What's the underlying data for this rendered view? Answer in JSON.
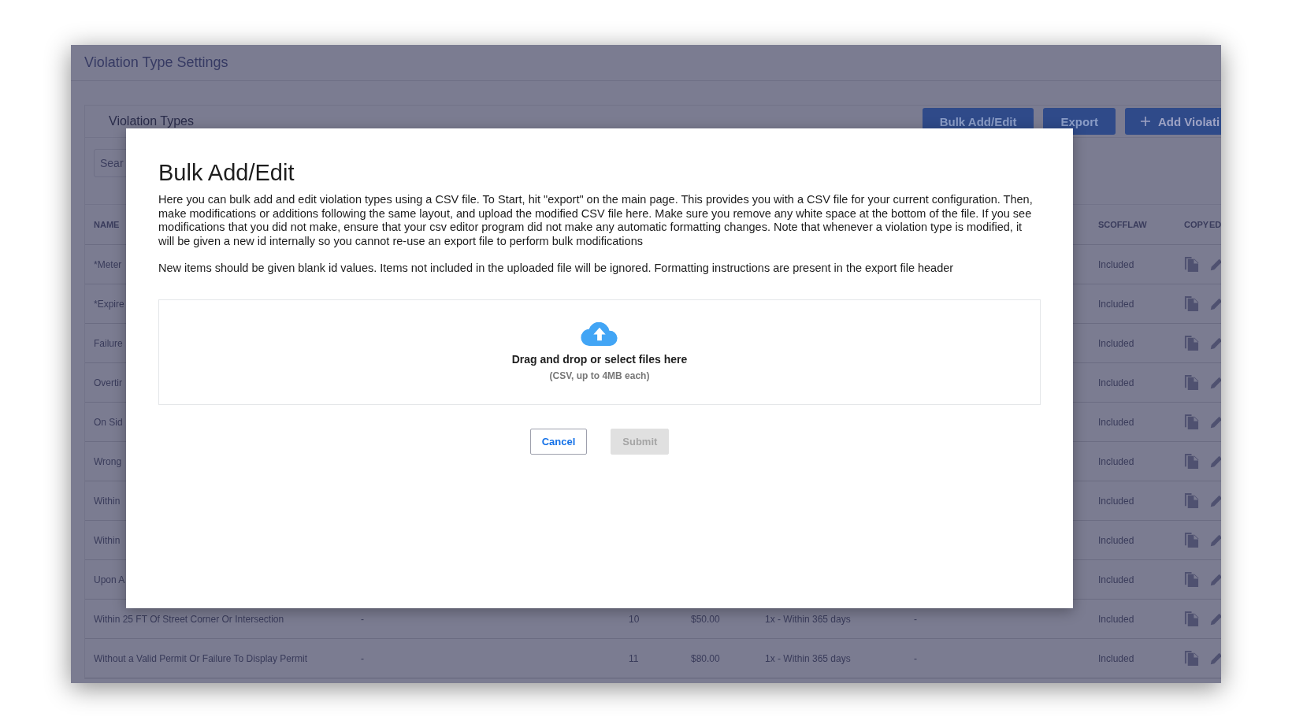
{
  "page": {
    "title": "Violation Type Settings"
  },
  "card": {
    "title": "Violation Types",
    "search": {
      "placeholder": "Sear"
    },
    "buttons": [
      {
        "label": "Bulk Add/Edit",
        "kind": "plain"
      },
      {
        "label": "Export",
        "kind": "plain"
      },
      {
        "label": "Add Violati",
        "kind": "add"
      }
    ]
  },
  "table": {
    "columns": [
      "NAME",
      "SCOFFLAW",
      "COPY",
      "ED"
    ],
    "rows": [
      {
        "name": "*Meter",
        "scofflaw": "Included"
      },
      {
        "name": "*Expire",
        "scofflaw": "Included"
      },
      {
        "name": "Failure",
        "scofflaw": "Included"
      },
      {
        "name": "Overtir",
        "scofflaw": "Included"
      },
      {
        "name": "On Sid",
        "scofflaw": "Included"
      },
      {
        "name": "Wrong",
        "scofflaw": "Included"
      },
      {
        "name": "Within",
        "scofflaw": "Included"
      },
      {
        "name": "Within",
        "scofflaw": "Included"
      },
      {
        "name": "Upon A",
        "scofflaw": "Included"
      },
      {
        "name": "Within 25 FT Of Street Corner Or Intersection",
        "column_2": "-",
        "column_3": "10",
        "column_4": "$50.00",
        "column_5": "1x - Within 365 days",
        "column_6": "-",
        "scofflaw": "Included"
      },
      {
        "name": "Without a Valid Permit Or Failure To Display Permit",
        "column_2": "-",
        "column_3": "11",
        "column_4": "$80.00",
        "column_5": "1x - Within 365 days",
        "column_6": "-",
        "scofflaw": "Included"
      }
    ]
  },
  "dialog": {
    "title": "Bulk Add/Edit",
    "paragraphs": [
      "Here you can bulk add and edit violation types using a CSV file. To Start, hit \"export\" on the main page. This provides you with a CSV file for your current configuration. Then, make modifications or additions following the same layout, and upload the modified CSV file here. Make sure you remove any white space at the bottom of the file. If you see modifications that you did not make, ensure that your csv editor program did not make any automatic formatting changes. Note that whenever a violation type is modified, it will be given a new id internally so you cannot re-use an export file to perform bulk modifications",
      "New items should be given blank id values. Items not included in the uploaded file will be ignored. Formatting instructions are present in the export file header"
    ],
    "dropzone": {
      "title": "Drag and drop or select files here",
      "hint": "(CSV, up to 4MB each)"
    },
    "buttons": [
      {
        "label": "Cancel",
        "disabled": false
      },
      {
        "label": "Submit",
        "disabled": true
      }
    ]
  }
}
